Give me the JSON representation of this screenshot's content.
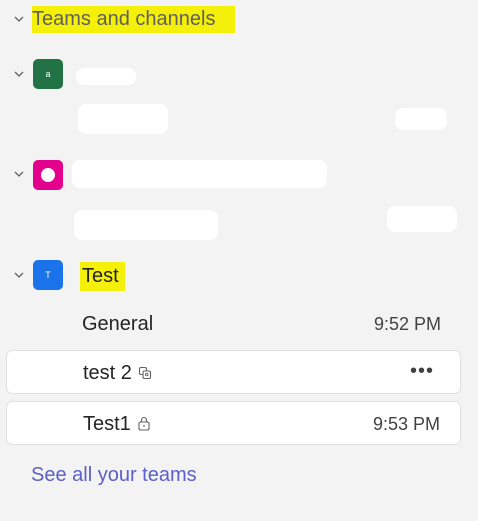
{
  "section": {
    "title": "Teams and channels"
  },
  "teams": [
    {
      "avatar_letter": "a",
      "avatar_color": "#217346"
    },
    {
      "avatar_letter": "",
      "avatar_color": "#e3008c"
    },
    {
      "avatar_letter": "T",
      "avatar_color": "#1a73e8",
      "name": "Test",
      "channels": [
        {
          "name": "General",
          "time": "9:52 PM",
          "icon": ""
        },
        {
          "name": "test 2",
          "time": "",
          "icon": "shared-channel-icon",
          "more": "•••"
        },
        {
          "name": "Test1",
          "time": "9:53 PM",
          "icon": "lock-icon"
        }
      ]
    }
  ],
  "footer": {
    "see_all_label": "See all your teams"
  },
  "colors": {
    "highlight": "#f5f00a",
    "link": "#5b5fc7",
    "background": "#f3f3f3"
  }
}
